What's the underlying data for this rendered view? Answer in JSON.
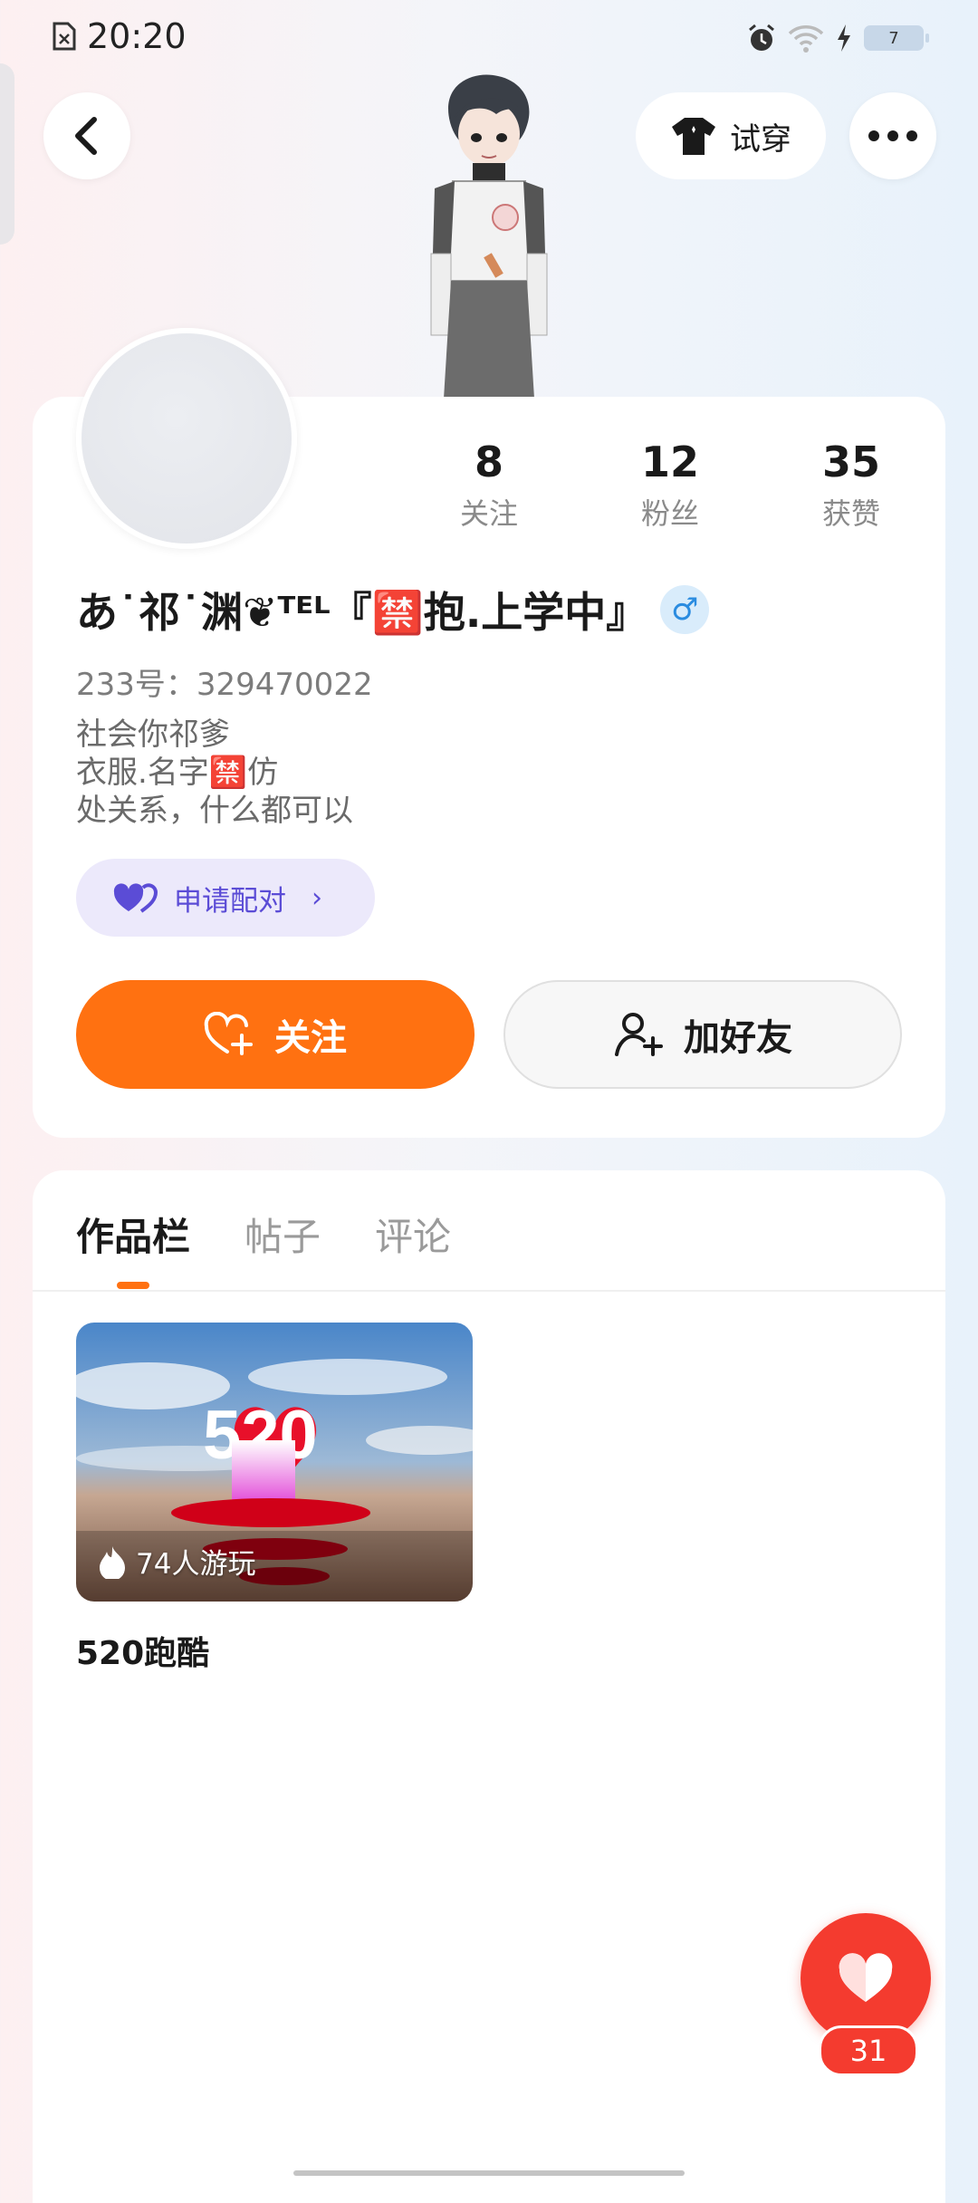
{
  "status_bar": {
    "time": "20:20",
    "battery": "7"
  },
  "header": {
    "tryon_label": "试穿"
  },
  "stats": [
    {
      "value": "8",
      "label": "关注"
    },
    {
      "value": "12",
      "label": "粉丝"
    },
    {
      "value": "35",
      "label": "获赞"
    }
  ],
  "profile": {
    "username": "あ˙祁˙渊❦ᵀᴱᴸ『🈲抱.上学中』",
    "gender_symbol": "♂",
    "uid": "233号：329470022",
    "bio": [
      "社会你祁爹",
      "衣服.名字🈲仿",
      "处关系，什么都可以"
    ]
  },
  "pair_button": {
    "label": "申请配对"
  },
  "actions": {
    "follow_label": "关注",
    "add_friend_label": "加好友"
  },
  "tabs": [
    {
      "label": "作品栏",
      "active": true
    },
    {
      "label": "帖子",
      "active": false
    },
    {
      "label": "评论",
      "active": false
    }
  ],
  "work": {
    "plays": "74人游玩",
    "title": "520跑酷"
  },
  "like_fab": {
    "count": "31"
  },
  "colors": {
    "accent_orange": "#ff7111",
    "like_red": "#f43b2f",
    "pair_purple": "#5b4cd6"
  }
}
